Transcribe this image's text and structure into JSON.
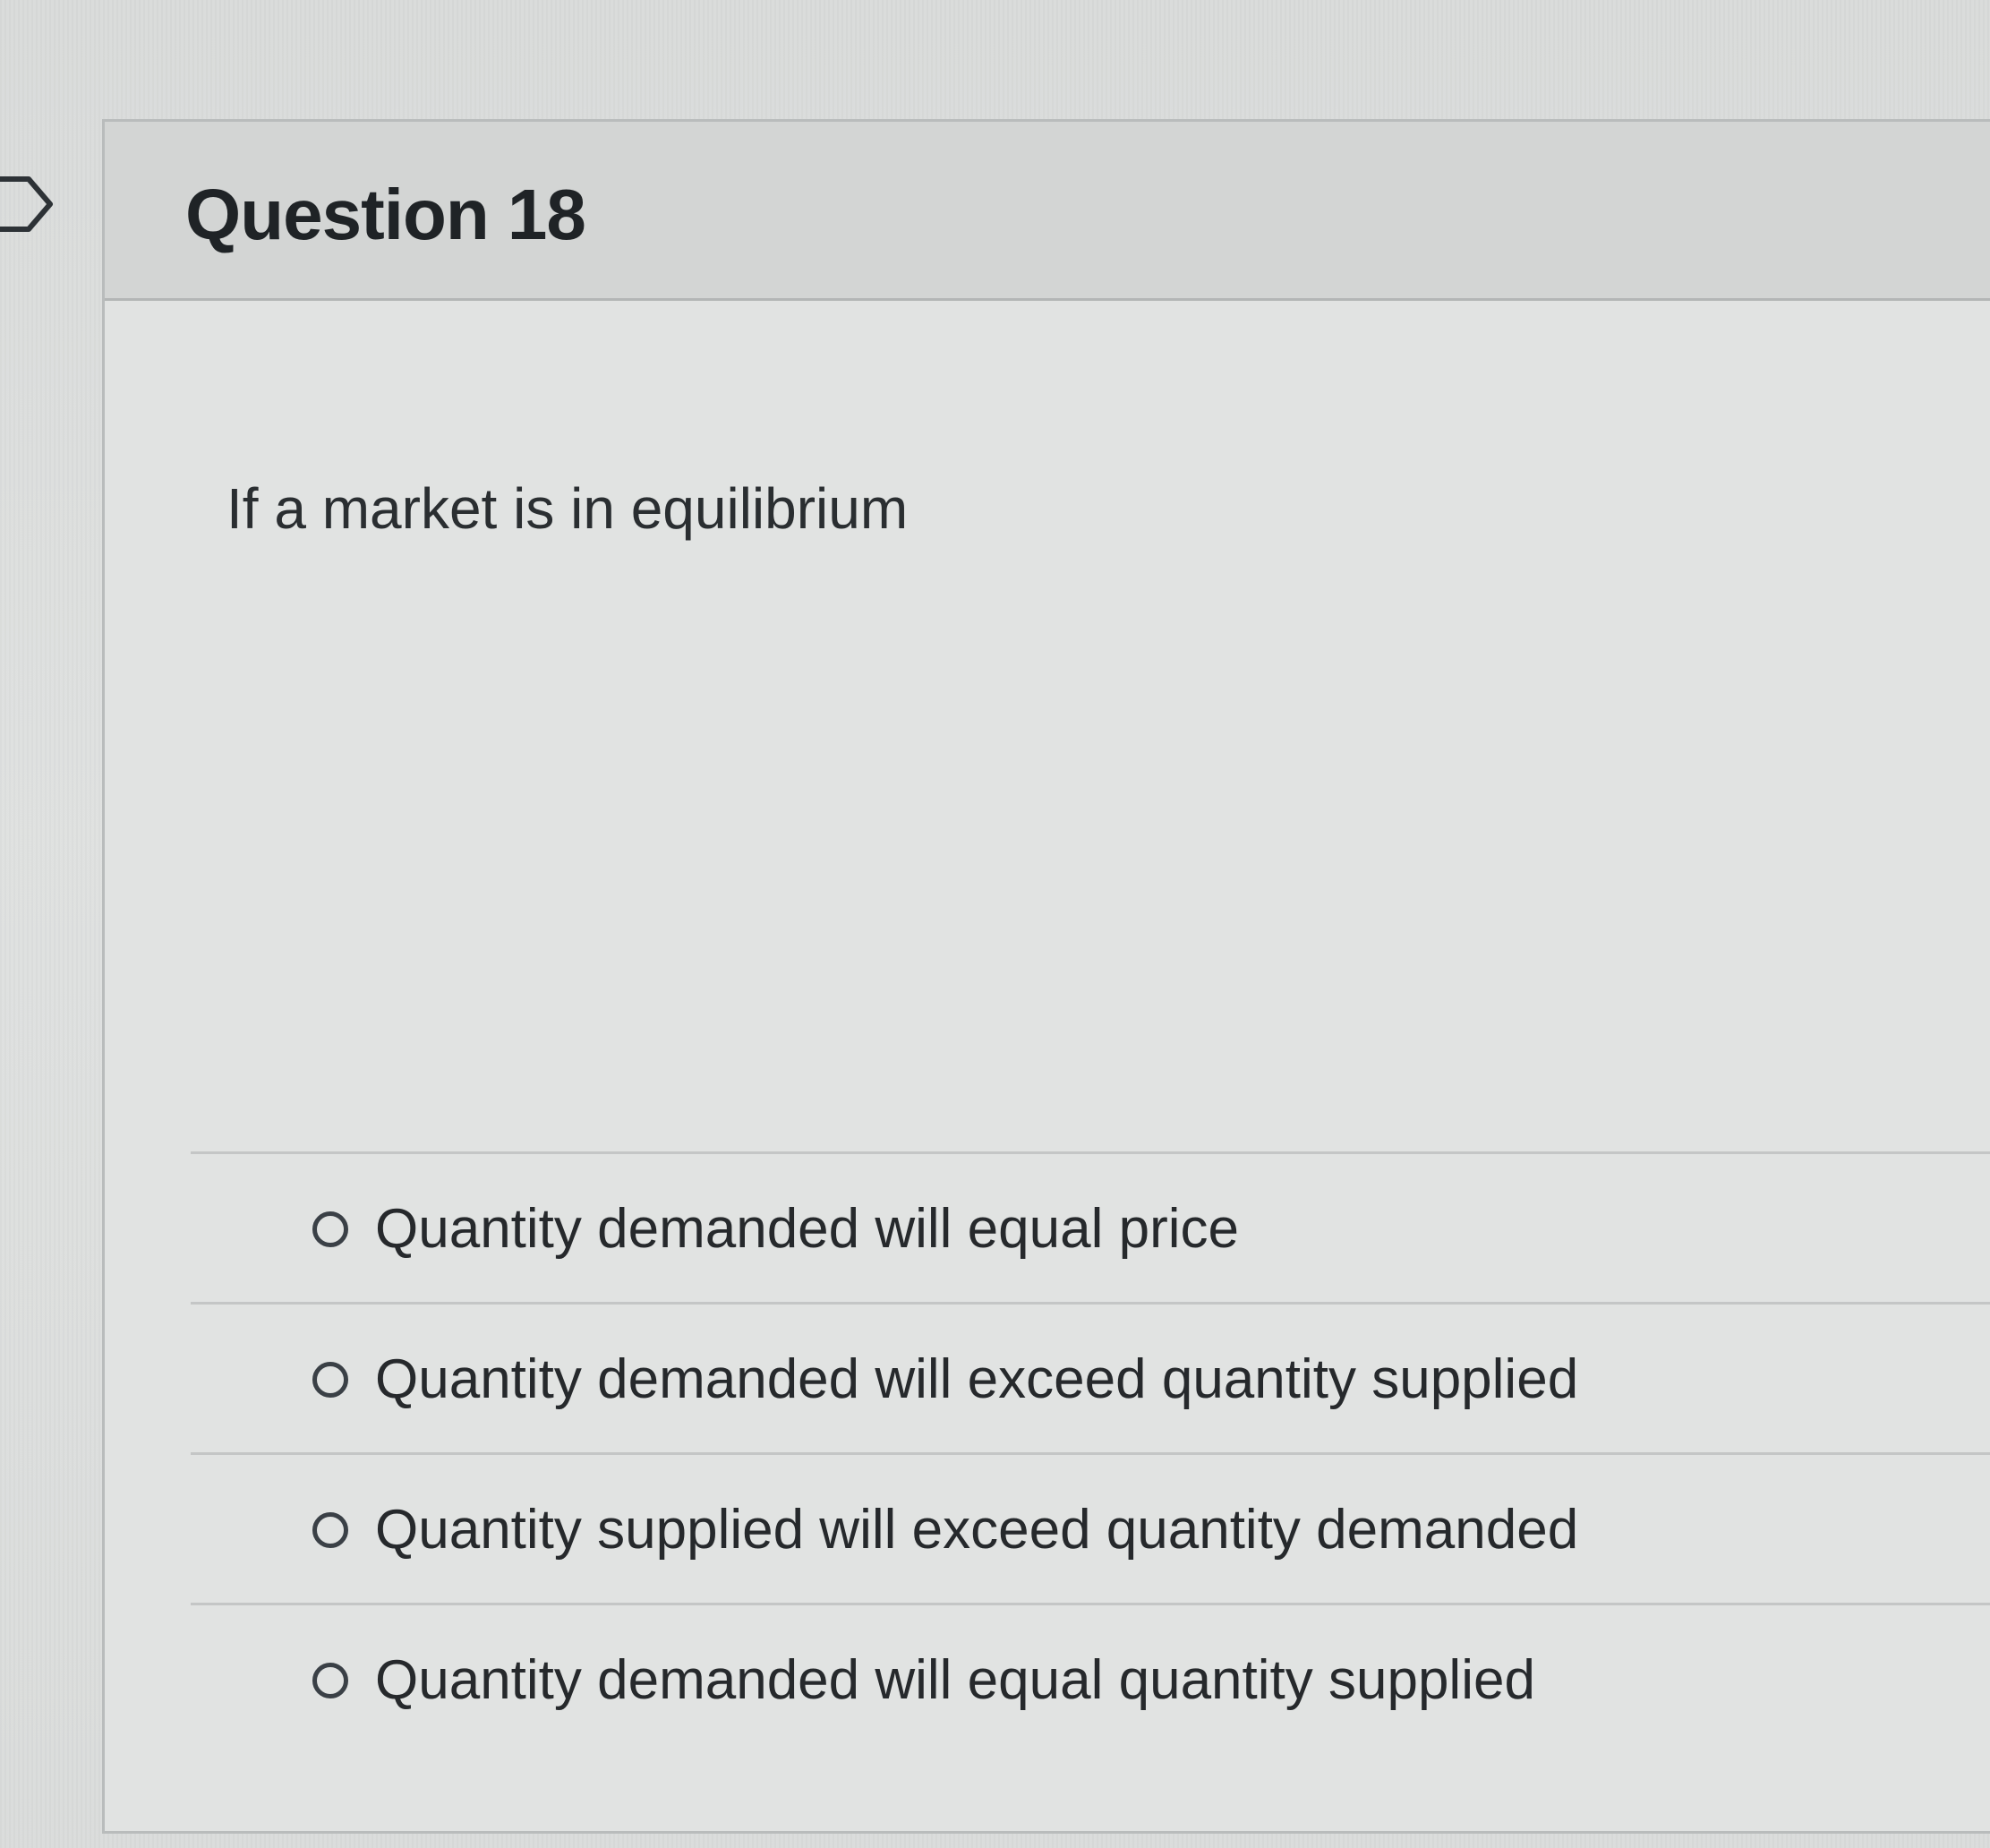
{
  "question": {
    "title": "Question 18",
    "text": "If a market is in equilibrium"
  },
  "answers": [
    {
      "label": "Quantity demanded will equal price",
      "selected": false
    },
    {
      "label": "Quantity demanded will exceed quantity supplied",
      "selected": false
    },
    {
      "label": "Quantity supplied will exceed quantity demanded",
      "selected": false
    },
    {
      "label": "Quantity demanded will equal quantity supplied",
      "selected": false
    }
  ],
  "icons": {
    "flag": "bookmark-flag-icon"
  },
  "colors": {
    "card_background": "#e1e3e2",
    "header_background": "#d3d5d4",
    "text": "#26292c"
  }
}
